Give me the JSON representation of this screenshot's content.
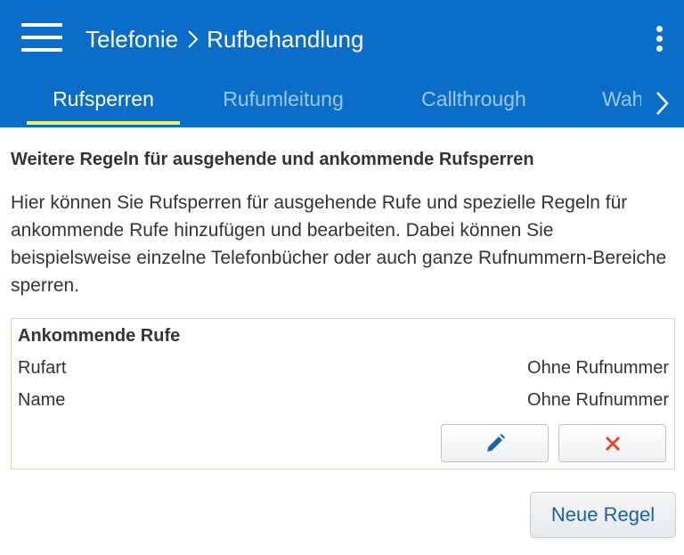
{
  "header": {
    "section": "Telefonie",
    "page": "Rufbehandlung",
    "background_color": "#0a6ec8"
  },
  "tabs": [
    {
      "label": "Rufsperren",
      "active": true
    },
    {
      "label": "Rufumleitung",
      "active": false
    },
    {
      "label": "Callthrough",
      "active": false
    },
    {
      "label": "Wah",
      "active": false
    }
  ],
  "content": {
    "heading": "Weitere Regeln für ausgehende und ankommende Rufsperren",
    "description": "Hier können Sie Rufsperren für ausgehende Rufe und spezielle Regeln für ankommende Rufe hinzufügen und bearbeiten. Dabei können Sie beispielsweise einzelne Telefonbücher oder auch ganze Rufnummern-Bereiche sperren."
  },
  "rule": {
    "title": "Ankommende Rufe",
    "rows": [
      {
        "label": "Rufart",
        "value": "Ohne Rufnummer"
      },
      {
        "label": "Name",
        "value": "Ohne Rufnummer"
      }
    ]
  },
  "actions": {
    "new_rule": "Neue Regel"
  },
  "icons": {
    "menu": "hamburger-menu-icon",
    "more": "more-vertical-icon",
    "next": "chevron-right-icon",
    "edit": "pencil-icon",
    "delete": "close-icon",
    "breadcrumb_separator": "chevron-right-icon"
  },
  "colors": {
    "accent": "#0a6ec8",
    "tab_indicator": "#eef06a",
    "delete": "#e8422a",
    "edit": "#1e5fa8"
  }
}
